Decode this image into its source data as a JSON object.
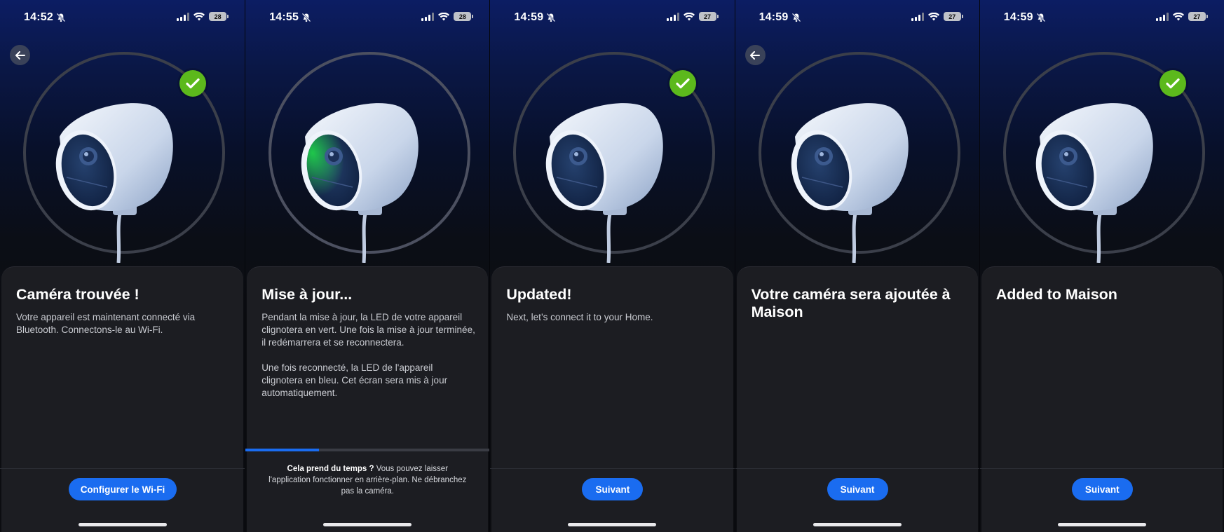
{
  "colors": {
    "accent": "#1a6cf0",
    "success": "#5cb91c",
    "sheet": "#1c1d22",
    "led_green": "#1fcf4a"
  },
  "screens": [
    {
      "time": "14:52",
      "battery": "28",
      "has_back": true,
      "has_check": true,
      "led_active": false,
      "title": "Caméra trouvée !",
      "body": [
        "Votre appareil est maintenant connecté via Bluetooth. Connectons-le au Wi-Fi."
      ],
      "button": "Configurer le Wi-Fi"
    },
    {
      "time": "14:55",
      "battery": "28",
      "has_back": false,
      "has_check": false,
      "led_active": true,
      "title": "Mise à jour...",
      "body": [
        "Pendant la mise à jour, la LED de votre appareil clignotera en vert. Une fois la mise à jour terminée, il redémarrera et se reconnectera.",
        "Une fois reconnecté, la LED de l'appareil clignotera en bleu. Cet écran sera mis à jour automatiquement."
      ],
      "progress": 0.3,
      "hint_bold": "Cela prend du temps ?",
      "hint_rest": " Vous pouvez laisser l'application fonctionner en arrière-plan. Ne débranchez pas la caméra."
    },
    {
      "time": "14:59",
      "battery": "27",
      "has_back": false,
      "has_check": true,
      "led_active": false,
      "title": "Updated!",
      "body": [
        "Next, let’s connect it to your Home."
      ],
      "button": "Suivant"
    },
    {
      "time": "14:59",
      "battery": "27",
      "has_back": true,
      "has_check": false,
      "led_active": false,
      "title": "Votre caméra sera ajoutée à Maison",
      "body": [],
      "button": "Suivant"
    },
    {
      "time": "14:59",
      "battery": "27",
      "has_back": false,
      "has_check": true,
      "led_active": false,
      "title": "Added to Maison",
      "body": [],
      "button": "Suivant"
    }
  ],
  "icons": {
    "back": "arrow-left-icon",
    "check": "checkmark-icon",
    "bell": "bell-slash-icon",
    "wifi": "wifi-icon",
    "signal": "cellular-signal-icon",
    "battery": "battery-icon",
    "camera": "security-camera-illustration"
  }
}
